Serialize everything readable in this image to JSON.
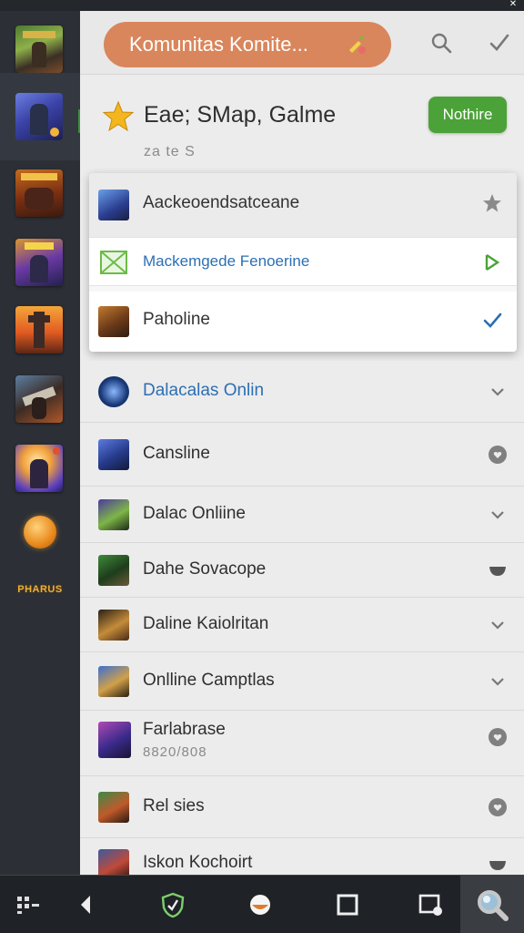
{
  "topbar": {
    "search_text": "Komunitas  Komite...",
    "search_icon": "search-icon",
    "check_icon": "check-icon"
  },
  "game_header": {
    "title": "Eae; SMap, Galme",
    "subtitle": "za te  S",
    "button_label": "Nothire",
    "button_color": "#4ba238"
  },
  "dropdown": [
    {
      "label": "Aackeoendsatceane",
      "trail_icon": "star-icon"
    },
    {
      "label": "Mackemgede Fenoerine",
      "trail_icon": "arrow-right-icon"
    },
    {
      "label": "Paholine",
      "trail_icon": "check-icon"
    }
  ],
  "list": [
    {
      "label": "Dalacalas Onlin",
      "trail_icon": "chevron-down-icon",
      "highlight": true
    },
    {
      "label": "Cansline",
      "trail_icon": "heart-icon"
    },
    {
      "label": "Dalac Onliine",
      "trail_icon": "chevron-down-icon"
    },
    {
      "label": "Dahe Sovacope",
      "trail_icon": "bowl-icon"
    },
    {
      "label": "Daline Kaiolritan",
      "trail_icon": "chevron-down-icon"
    },
    {
      "label": "Onlline Camptlas",
      "trail_icon": "chevron-down-icon"
    },
    {
      "label": "Farlabrase",
      "sub": "8820/808",
      "trail_icon": "heart-icon"
    },
    {
      "label": "Rel sies",
      "trail_icon": "heart-icon"
    },
    {
      "label": "Iskon Kochoirt",
      "trail_icon": "bowl-icon"
    }
  ],
  "colors": {
    "accent_orange": "#d9865c",
    "accent_green": "#4ba238",
    "link_blue": "#2c6fb3",
    "rail_bg": "#2c3036"
  },
  "rail_logo_text": "PHARUS",
  "bottom_nav": [
    "grid-icon",
    "back-icon",
    "shield-icon",
    "home-icon",
    "square-icon",
    "window-icon",
    "search-magnifier-icon"
  ]
}
